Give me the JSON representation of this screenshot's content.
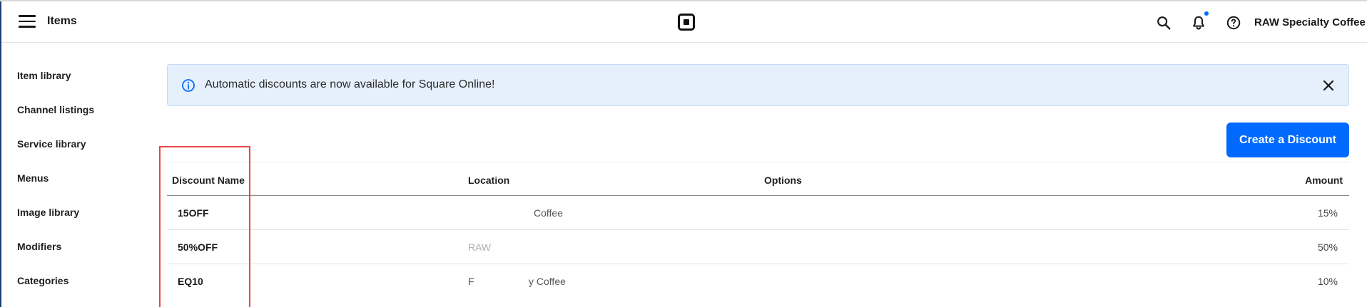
{
  "header": {
    "app_title": "Items",
    "business_name": "RAW Specialty Coffee",
    "icons": [
      "menu-icon",
      "square-logo-icon",
      "search-icon",
      "bell-icon",
      "help-icon"
    ]
  },
  "sidebar": {
    "items": [
      {
        "label": "Item library"
      },
      {
        "label": "Channel listings"
      },
      {
        "label": "Service library"
      },
      {
        "label": "Menus"
      },
      {
        "label": "Image library"
      },
      {
        "label": "Modifiers"
      },
      {
        "label": "Categories"
      }
    ]
  },
  "banner": {
    "text": "Automatic discounts are now available for Square Online!"
  },
  "actions": {
    "create_label": "Create a Discount"
  },
  "table": {
    "columns": [
      "Discount Name",
      "Location",
      "Options",
      "Amount"
    ],
    "rows": [
      {
        "name": "15OFF",
        "location": "Coffee",
        "options": "",
        "amount": "15%"
      },
      {
        "name": "50%OFF",
        "location": "RAW",
        "options": "",
        "amount": "50%"
      },
      {
        "name": "EQ10",
        "location": "y Coffee",
        "options": "",
        "amount": "10%"
      }
    ]
  },
  "colors": {
    "accent": "#006aff",
    "banner_bg": "#e6f0fd",
    "highlight": "#e8484a"
  }
}
